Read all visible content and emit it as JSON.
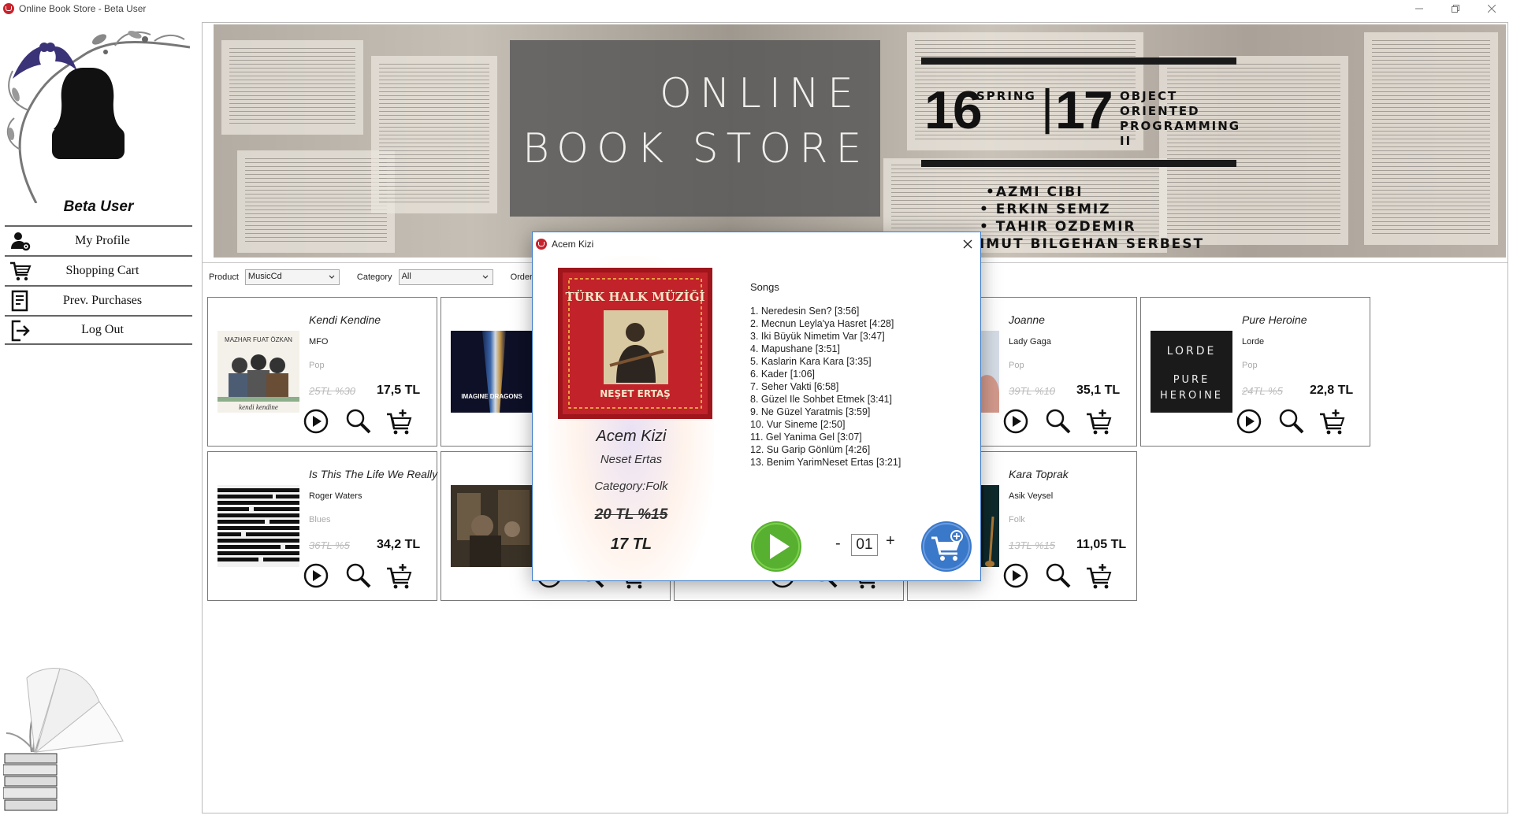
{
  "window": {
    "title": "Online Book Store - Beta User",
    "controls": [
      "minimize-icon",
      "restore-icon",
      "close-icon"
    ]
  },
  "sidebar": {
    "user_name": "Beta User",
    "menu": [
      {
        "label": "My Profile",
        "icon": "profile-settings-icon"
      },
      {
        "label": "Shopping Cart",
        "icon": "shopping-cart-icon"
      },
      {
        "label": "Prev. Purchases",
        "icon": "receipt-icon"
      },
      {
        "label": "Log Out",
        "icon": "logout-icon"
      }
    ]
  },
  "banner": {
    "title_line1": "ONLINE",
    "title_line2": "BOOK STORE",
    "year1": "16",
    "season": "SPRING",
    "year2": "17",
    "course": [
      "OBJECT",
      "ORIENTED",
      "PROGRAMMING",
      "II"
    ],
    "authors": [
      "•AZMI CIBI",
      "• ERKIN SEMIZ",
      "• TAHIR OZDEMIR",
      "MAHMUT BILGEHAN SERBEST"
    ]
  },
  "filters": {
    "product_label": "Product",
    "product_value": "MusicCd",
    "category_label": "Category",
    "category_value": "All",
    "order_label": "Order"
  },
  "products": [
    {
      "title": "Kendi Kendine",
      "artist": "MFO",
      "genre": "Pop",
      "old_price": "25TL %30",
      "new_price": "17,5 TL"
    },
    {
      "title": "",
      "artist": "",
      "genre": "",
      "old_price": "",
      "new_price": "",
      "cover_text": "IMAGINE DRAGONS"
    },
    {
      "title": "",
      "artist": "",
      "genre": "",
      "old_price": "",
      "new_price": ""
    },
    {
      "title": "Joanne",
      "artist": "Lady Gaga",
      "genre": "Pop",
      "old_price": "39TL %10",
      "new_price": "35,1 TL"
    },
    {
      "title": "Pure Heroine",
      "artist": "Lorde",
      "genre": "Pop",
      "old_price": "24TL %5",
      "new_price": "22,8 TL",
      "cover_text": "LORDE PURE HEROINE"
    },
    {
      "title": "Is This The Life We Really",
      "artist": "Roger Waters",
      "genre": "Blues",
      "old_price": "36TL %5",
      "new_price": "34,2 TL"
    },
    {
      "title": "",
      "artist": "",
      "genre": "",
      "old_price": "",
      "new_price": ""
    },
    {
      "title": "",
      "artist": "",
      "genre": "",
      "old_price": "",
      "new_price": ""
    },
    {
      "title": "Kara Toprak",
      "artist": "Asik Veysel",
      "genre": "Folk",
      "old_price": "13TL %15",
      "new_price": "11,05 TL"
    }
  ],
  "card_actions": [
    "play-icon",
    "search-icon",
    "add-to-cart-icon"
  ],
  "modal": {
    "title": "Acem Kizi",
    "cover_top_text": "TÜRK HALK MÜZİĞİ",
    "cover_bottom_text": "NEŞET ERTAŞ",
    "album": "Acem Kizi",
    "artist": "Neset Ertas",
    "category": "Category:Folk",
    "old_price": "20 TL %15",
    "new_price": "17 TL",
    "songs_header": "Songs",
    "songs": [
      "1. Neredesin Sen? [3:56]",
      "2. Mecnun Leyla'ya Hasret [4:28]",
      "3. Iki Büyük Nimetim Var [3:47]",
      "4. Mapushane [3:51]",
      "5. Kaslarin Kara Kara [3:35]",
      "6. Kader [1:06]",
      "7. Seher Vakti [6:58]",
      "8. Güzel Ile Sohbet Etmek [3:41]",
      "9. Ne Güzel Yaratmis [3:59]",
      "10. Vur Sineme [2:50]",
      "11. Gel Yanima Gel [3:07]",
      "12. Su Garip Gönlüm [4:26]",
      "13. Benim YarimNeset Ertas [3:21]"
    ],
    "qty_minus": "-",
    "qty_value": "01",
    "qty_plus": "+"
  },
  "colors": {
    "accent_blue": "#3f7cc7",
    "play_green": "#58b030",
    "cart_blue": "#3a78c9",
    "album_red": "#c22229"
  }
}
